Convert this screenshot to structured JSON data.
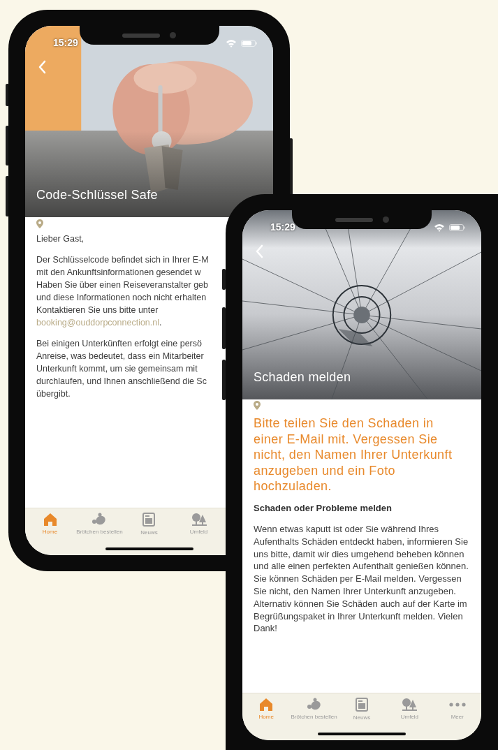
{
  "phones": [
    {
      "status_time": "15:29",
      "title": "Code-Schlüssel Safe",
      "picture": {
        "kind": "picture"
      },
      "content": [
        {
          "kind": "lines",
          "lines": [
            {
              "text": "Lieber Gast,"
            }
          ]
        },
        {
          "kind": "lines",
          "lines": [
            {
              "text": "Der Schlüsselcode befindet sich in Ihrer E-M"
            },
            {
              "text": "mit den Ankunftsinformationen gesendet w"
            },
            {
              "text": "Haben Sie über einen Reiseveranstalter geb"
            },
            {
              "text": "und diese Informationen noch nicht erhalten"
            },
            {
              "text": "Kontaktieren Sie uns bitte unter"
            },
            {
              "link": "booking@ouddorpconnection.nl",
              "text": "."
            }
          ]
        },
        {
          "kind": "lines",
          "lines": [
            {
              "text": "Bei einigen Unterkünften erfolgt eine persö"
            },
            {
              "text": "Anreise, was bedeutet, dass ein Mitarbeiter"
            },
            {
              "text": "Unterkunft kommt, um sie gemeinsam mit"
            },
            {
              "text": "durchlaufen, und Ihnen anschließend die Sc"
            },
            {
              "text": "übergibt."
            }
          ]
        }
      ],
      "nav": [
        {
          "label": "Home",
          "selected": true
        },
        {
          "label": "Brötchen bestellen",
          "selected": false
        },
        {
          "label": "Neuws",
          "selected": false
        },
        {
          "label": "Umfeld",
          "selected": false
        }
      ]
    },
    {
      "status_time": "15:29",
      "title": "Schaden melden",
      "picture": {
        "kind": "picture"
      },
      "content": [
        {
          "kind": "lead",
          "text": "Bitte teilen Sie den Schaden in einer E-Mail mit. Vergessen Sie nicht, den Namen Ihrer Unterkunft anzugeben und ein Foto hochzuladen."
        },
        {
          "kind": "subheading",
          "text": "Schaden oder Probleme melden"
        },
        {
          "kind": "paragraph",
          "text": "Wenn etwas kaputt ist oder Sie während Ihres Aufenthalts Schäden entdeckt haben, informieren Sie uns bitte, damit wir dies umgehend beheben können und alle einen perfekten Aufenthalt genießen können. Sie können Schäden per E-Mail melden. Vergessen Sie nicht, den Namen Ihrer Unterkunft anzugeben. Alternativ können Sie Schäden auch auf der Karte im Begrüßungspaket in Ihrer Unterkunft melden. Vielen Dank!"
        }
      ],
      "nav": [
        {
          "label": "Home",
          "selected": true
        },
        {
          "label": "Brötchen bestellen",
          "selected": false
        },
        {
          "label": "Neuws",
          "selected": false
        },
        {
          "label": "Umfeld",
          "selected": false
        },
        {
          "label": "Meer",
          "selected": false
        }
      ]
    }
  ]
}
